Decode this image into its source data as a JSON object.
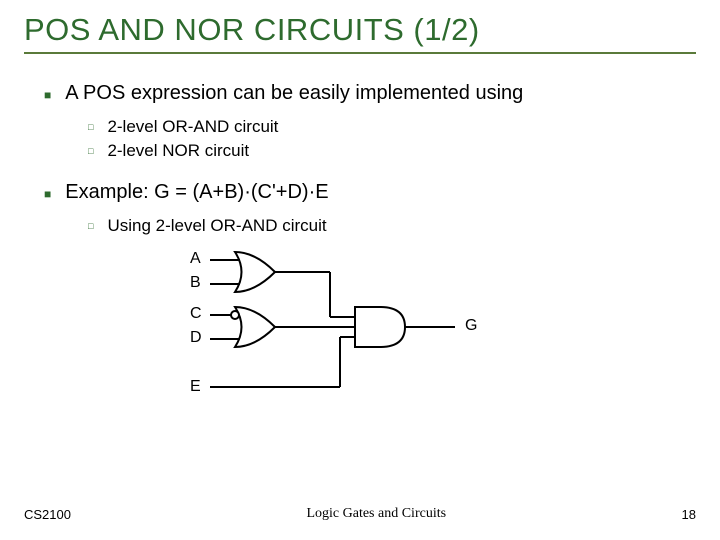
{
  "title": "POS AND NOR CIRCUITS (1/2)",
  "bullets": {
    "b1": "A POS expression can be easily implemented using",
    "b1a": "2-level OR-AND circuit",
    "b1b": "2-level NOR circuit",
    "b2": "Example: G = (A+B)·(C'+D)·E",
    "b2a": "Using 2-level OR-AND circuit"
  },
  "labels": {
    "A": "A",
    "B": "B",
    "C": "C",
    "D": "D",
    "E": "E",
    "G": "G"
  },
  "footer": {
    "left": "CS2100",
    "mid": "Logic Gates and Circuits",
    "right": "18"
  },
  "chart_data": {
    "type": "diagram",
    "description": "2-level OR-AND logic circuit",
    "inputs": [
      "A",
      "B",
      "C",
      "D",
      "E"
    ],
    "output": "G",
    "gates": [
      {
        "id": "or1",
        "type": "OR",
        "inputs": [
          "A",
          "B"
        ]
      },
      {
        "id": "or2",
        "type": "OR",
        "inputs": [
          "C'",
          "D"
        ],
        "note": "C input has NOT bubble"
      },
      {
        "id": "and1",
        "type": "AND",
        "inputs": [
          "or1",
          "or2",
          "E"
        ],
        "output": "G"
      }
    ],
    "expression": "G = (A+B)·(C'+D)·E"
  }
}
